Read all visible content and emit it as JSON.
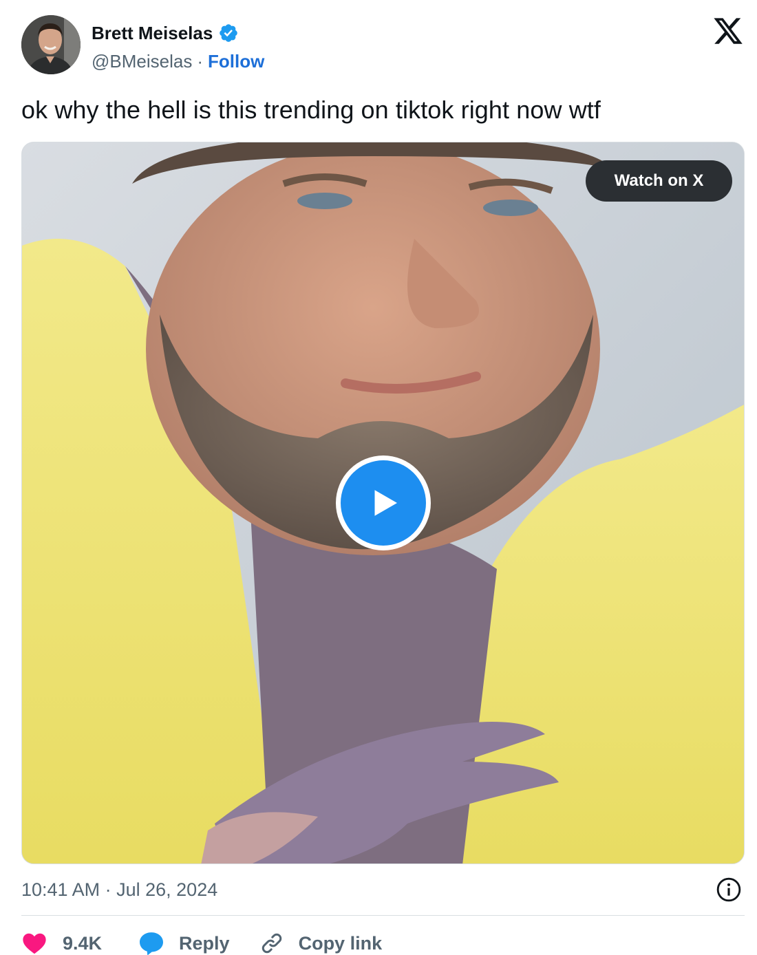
{
  "author": {
    "display_name": "Brett Meiselas",
    "handle": "@BMeiselas",
    "separator": "·",
    "follow_label": "Follow",
    "verified": true
  },
  "tweet": {
    "text": "ok why the hell is this trending on tiktok right now wtf"
  },
  "media": {
    "type": "video",
    "watch_label": "Watch on X"
  },
  "meta": {
    "time": "10:41 AM",
    "separator": "·",
    "date": "Jul 26, 2024"
  },
  "actions": {
    "like_count": "9.4K",
    "reply_label": "Reply",
    "copy_link_label": "Copy link"
  },
  "icons": [
    "verified-badge-icon",
    "x-logo-icon",
    "play-icon",
    "info-icon",
    "heart-icon",
    "reply-bubble-icon",
    "link-icon"
  ],
  "colors": {
    "link_blue": "#1d6fd8",
    "verified_blue": "#1d9bf0",
    "play_blue": "#1d8ef0",
    "heart_pink": "#f91880",
    "text_primary": "#0f1419",
    "text_secondary": "#536471"
  }
}
